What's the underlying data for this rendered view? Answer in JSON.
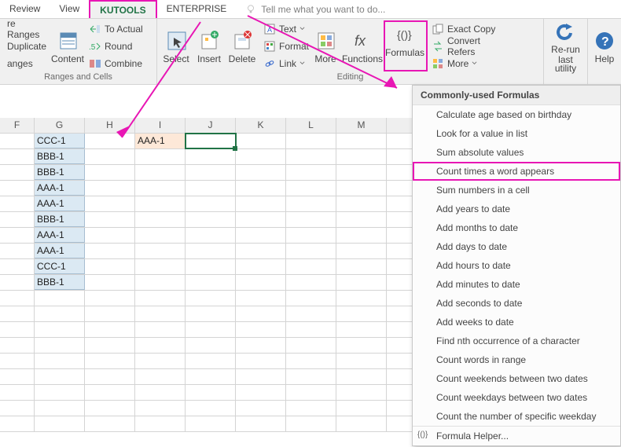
{
  "tabs": {
    "review": "Review",
    "view": "View",
    "kutools": "KUTOOLS",
    "enterprise": "ENTERPRISE",
    "tell": "Tell me what you want to do..."
  },
  "ribbon": {
    "reRanges": "re Ranges",
    "duplicate": "Duplicate",
    "anges": "anges",
    "groupRanges": "Ranges and Cells",
    "content": "Content",
    "toActual": "To Actual",
    "round": "Round",
    "combine": "Combine",
    "select": "Select",
    "insert": "Insert",
    "delete": "Delete",
    "text": "Text",
    "format": "Format",
    "link": "Link",
    "more1": "More",
    "functions": "Functions",
    "formulas": "Formulas",
    "groupEditing": "Editing",
    "exactCopy": "Exact Copy",
    "convertRefers": "Convert Refers",
    "more2": "More",
    "rerun": "Re-run",
    "lastUtility": "last utility",
    "help": "Help"
  },
  "cols": {
    "F": "F",
    "G": "G",
    "H": "H",
    "I": "I",
    "J": "J",
    "K": "K",
    "L": "L",
    "M": "M"
  },
  "cells": {
    "g": [
      "CCC-1",
      "BBB-1",
      "BBB-1",
      "AAA-1",
      "AAA-1",
      "BBB-1",
      "AAA-1",
      "AAA-1",
      "CCC-1",
      "BBB-1"
    ],
    "i1": "AAA-1"
  },
  "menu": {
    "title": "Commonly-used Formulas",
    "items": [
      "Calculate age based on birthday",
      "Look for a value in list",
      "Sum absolute values",
      "Count times a word appears",
      "Sum numbers in a cell",
      "Add years to date",
      "Add months to date",
      "Add days to date",
      "Add hours to date",
      "Add minutes to date",
      "Add seconds to date",
      "Add weeks to date",
      "Find nth occurrence of a character",
      "Count words in range",
      "Count weekends between two dates",
      "Count weekdays between two dates",
      "Count the number of specific weekday"
    ],
    "helper": "Formula Helper..."
  }
}
